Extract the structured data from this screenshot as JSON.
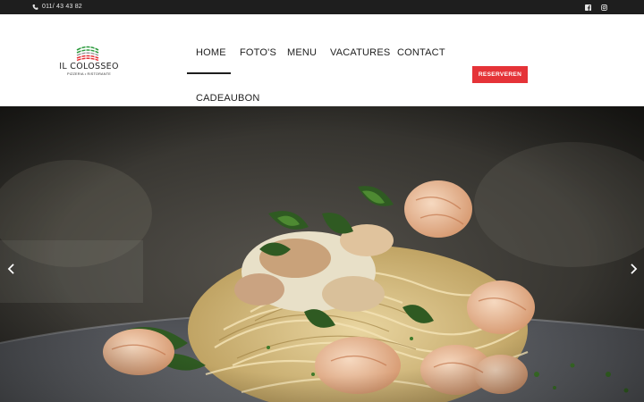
{
  "topbar": {
    "phone_icon": "phone-icon",
    "phone": "011/ 43 43 82",
    "social": [
      "facebook-icon",
      "instagram-icon"
    ]
  },
  "logo": {
    "name": "IL COLOSSEO",
    "tagline": "PIZZERIA • RISTORANTE",
    "colors": [
      "#2e9c3f",
      "#ffffff",
      "#e53338"
    ]
  },
  "nav": {
    "items": [
      "HOME",
      "FOTO'S",
      "MENU",
      "VACATURES",
      "CONTACT",
      "CADEAUBON"
    ],
    "active": "HOME"
  },
  "header": {
    "reserve_label": "RESERVEREN"
  },
  "hero": {
    "image": "spaghetti with shrimp, chicken and spinach cream sauce",
    "prev_icon": "chevron-left-icon",
    "next_icon": "chevron-right-icon"
  },
  "colors": {
    "topbar": "#1e1e1e",
    "accent": "#e53338",
    "text": "#1e1e1e"
  }
}
